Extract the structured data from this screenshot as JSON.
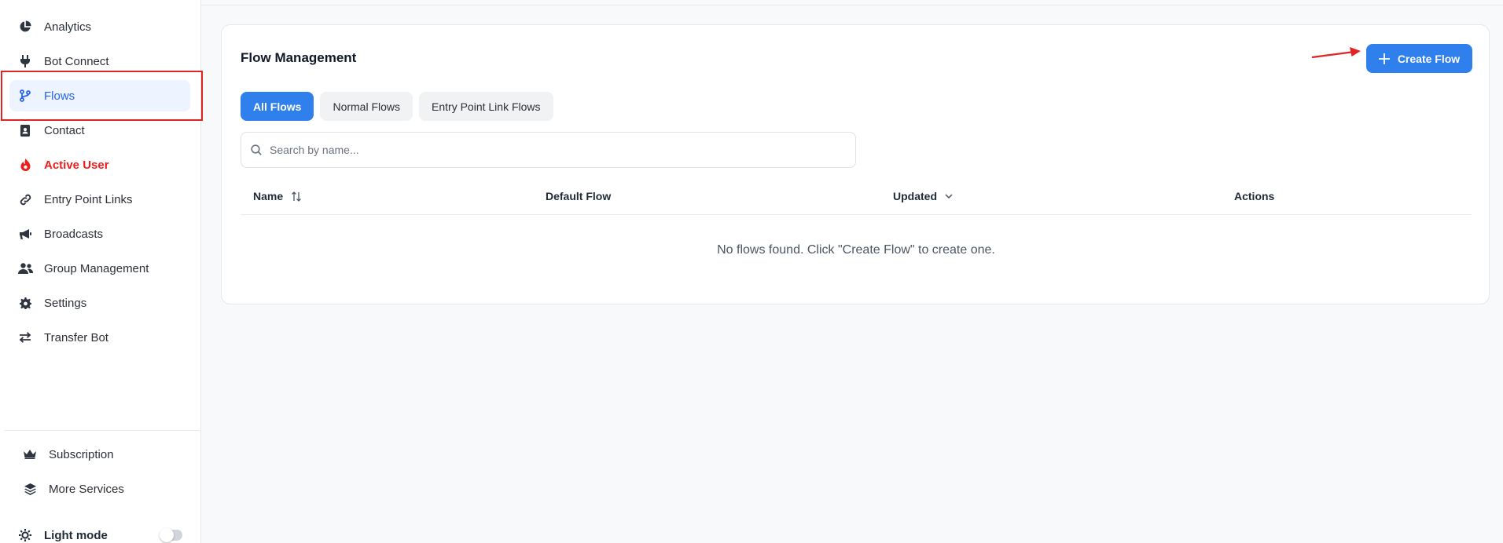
{
  "sidebar": {
    "items": [
      {
        "label": "Analytics",
        "icon": "chart-pie-icon"
      },
      {
        "label": "Bot Connect",
        "icon": "plug-icon"
      },
      {
        "label": "Flows",
        "icon": "code-branch-icon",
        "active": true
      },
      {
        "label": "Contact",
        "icon": "address-book-icon"
      },
      {
        "label": "Active User",
        "icon": "fire-icon"
      },
      {
        "label": "Entry Point Links",
        "icon": "link-icon"
      },
      {
        "label": "Broadcasts",
        "icon": "megaphone-icon"
      },
      {
        "label": "Group Management",
        "icon": "users-icon"
      },
      {
        "label": "Settings",
        "icon": "gear-icon"
      },
      {
        "label": "Transfer Bot",
        "icon": "arrows-exchange-icon"
      }
    ],
    "bottom_items": [
      {
        "label": "Subscription",
        "icon": "crown-icon"
      },
      {
        "label": "More Services",
        "icon": "layers-icon"
      }
    ],
    "theme": {
      "label": "Light mode",
      "icon": "sun-icon"
    }
  },
  "main": {
    "title": "Flow Management",
    "create_button": "Create Flow",
    "tabs": [
      {
        "label": "All Flows",
        "active": true
      },
      {
        "label": "Normal Flows"
      },
      {
        "label": "Entry Point Link Flows"
      }
    ],
    "search_placeholder": "Search by name...",
    "columns": [
      "Name",
      "Default Flow",
      "Updated",
      "Actions"
    ],
    "empty_message": "No flows found. Click \"Create Flow\" to create one."
  },
  "colors": {
    "accent": "#2f80ed",
    "active_user": "#ef1c1c",
    "highlight": "#e02424"
  }
}
